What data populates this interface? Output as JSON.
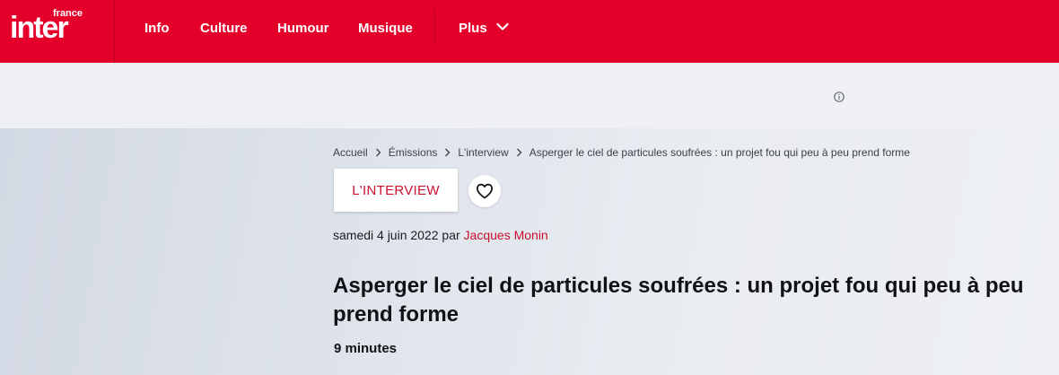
{
  "header": {
    "logo_small": "france",
    "logo_big": "inter",
    "nav": [
      {
        "label": "Info"
      },
      {
        "label": "Culture"
      },
      {
        "label": "Humour"
      },
      {
        "label": "Musique"
      }
    ],
    "more_label": "Plus",
    "brand_color": "#e4002b"
  },
  "ad": {
    "info_icon": "info-circle-icon"
  },
  "breadcrumb": {
    "items": [
      "Accueil",
      "Émissions",
      "L'interview",
      "Asperger le ciel de particules soufrées : un projet fou qui peu à peu prend forme"
    ]
  },
  "article": {
    "tag": "L'INTERVIEW",
    "favorite_icon": "heart-icon",
    "date": "samedi 4 juin 2022",
    "by": "par",
    "author": "Jacques Monin",
    "title": "Asperger le ciel de particules soufrées : un projet fou qui peu à peu prend forme",
    "duration": "9 minutes",
    "accent_color": "#c8102e"
  }
}
